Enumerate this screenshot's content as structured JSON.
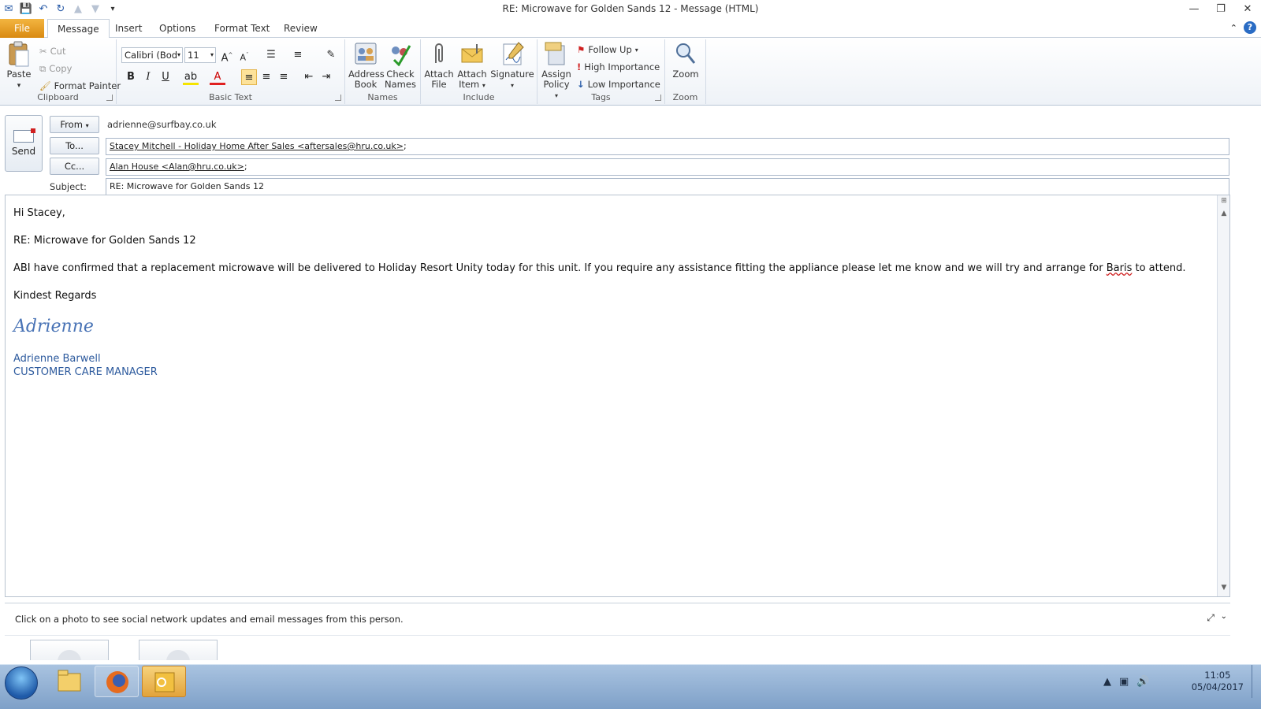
{
  "window": {
    "title": "RE: Microwave for Golden Sands 12  -  Message (HTML)"
  },
  "tabs": [
    "File",
    "Message",
    "Insert",
    "Options",
    "Format Text",
    "Review"
  ],
  "ribbon": {
    "clipboard": {
      "paste": "Paste",
      "cut": "Cut",
      "copy": "Copy",
      "format_painter": "Format Painter",
      "label": "Clipboard"
    },
    "basic_text": {
      "font_name": "Calibri (Bod",
      "font_size": "11",
      "label": "Basic Text"
    },
    "names": {
      "address_book": [
        "Address",
        "Book"
      ],
      "check_names": [
        "Check",
        "Names"
      ],
      "label": "Names"
    },
    "include": {
      "attach_file": [
        "Attach",
        "File"
      ],
      "attach_item": [
        "Attach",
        "Item"
      ],
      "signature": "Signature",
      "label": "Include"
    },
    "tags": {
      "assign_policy": [
        "Assign",
        "Policy"
      ],
      "follow_up": "Follow Up",
      "high_importance": "High Importance",
      "low_importance": "Low Importance",
      "label": "Tags"
    },
    "zoom": {
      "zoom_btn": "Zoom",
      "label": "Zoom"
    }
  },
  "header": {
    "send": "Send",
    "from_btn": "From",
    "from_value": "adrienne@surfbay.co.uk",
    "to_btn": "To...",
    "to_value": "Stacey Mitchell - Holiday Home After Sales <aftersales@hru.co.uk>",
    "cc_btn": "Cc...",
    "cc_value": "Alan House <Alan@hru.co.uk>",
    "subject_label": "Subject:",
    "subject_value": "RE: Microwave for Golden Sands 12"
  },
  "body": {
    "greeting": "Hi Stacey,",
    "re_line": "RE: Microwave for Golden Sands 12",
    "paragraph_before": "ABI have confirmed that a replacement microwave will be delivered to Holiday Resort Unity today for this unit.  If you require any assistance fitting the appliance please let me know and we will try and arrange for ",
    "misspelled": "Baris",
    "paragraph_after": " to attend.",
    "closing": "Kindest Regards",
    "signature_script": "Adrienne",
    "sig_name": "Adrienne Barwell",
    "sig_title": "CUSTOMER CARE MANAGER"
  },
  "people_pane": {
    "message": "Click on a photo to see social network updates and email messages from this person."
  },
  "taskbar": {
    "time": "11:05",
    "date": "05/04/2017"
  },
  "colors": {
    "file_tab": "#e8a020",
    "signature": "#2e5b9e",
    "taskbar": "#94b3d6"
  }
}
